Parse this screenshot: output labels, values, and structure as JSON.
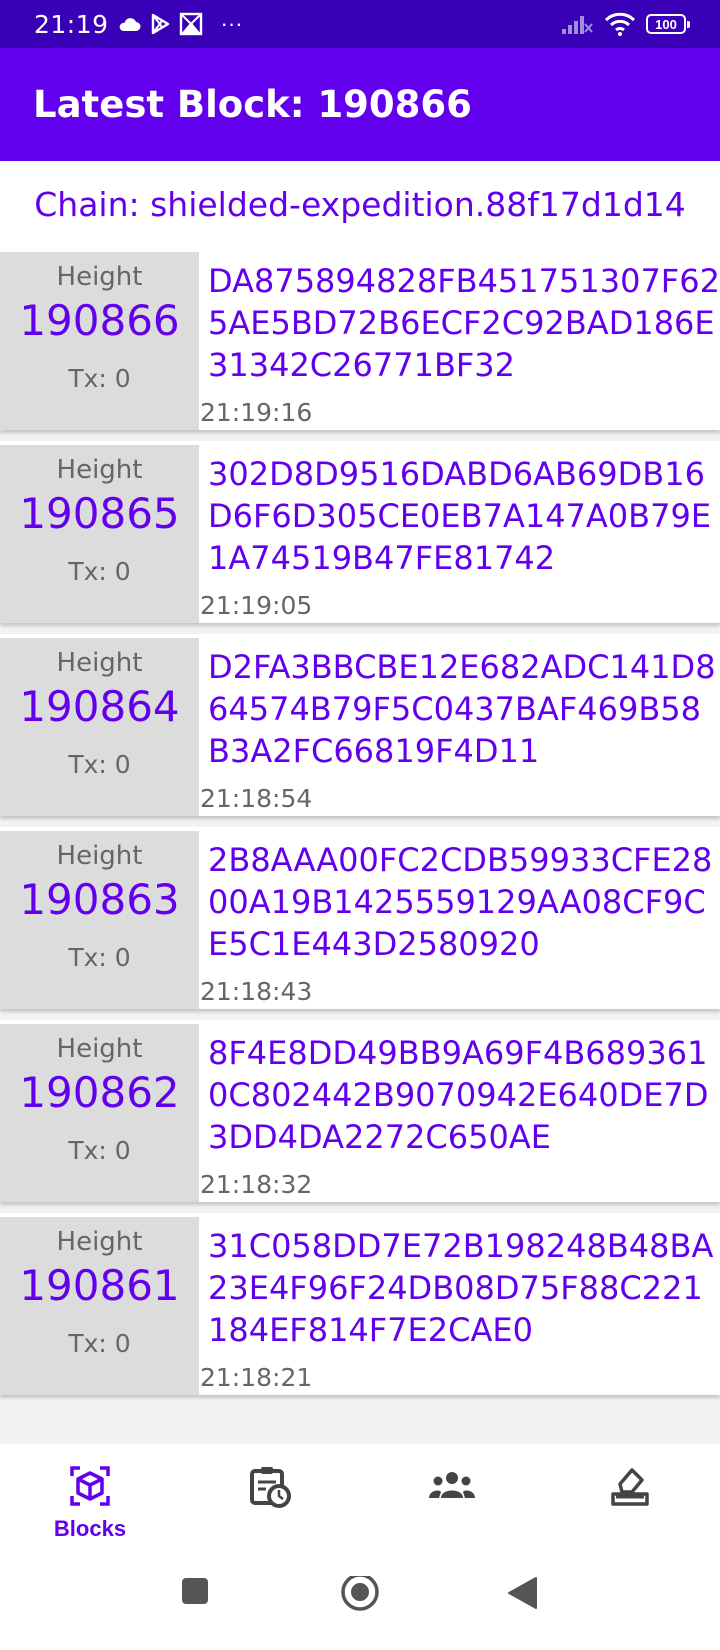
{
  "status_bar": {
    "time": "21:19",
    "more": "···",
    "battery": "100",
    "icons": [
      "cloud-icon",
      "play-store-icon",
      "gallery-icon",
      "signal-icon",
      "wifi-icon",
      "battery-icon"
    ]
  },
  "app_bar": {
    "title": "Latest Block: 190866"
  },
  "chain": {
    "label": "Chain: shielded-expedition.88f17d1d14"
  },
  "blocks": [
    {
      "height_label": "Height",
      "height": "190866",
      "tx": "Tx: 0",
      "hash": "DA875894828FB451751307F625AE5BD72B6ECF2C92BAD186E31342C26771BF32",
      "time": "21:19:16"
    },
    {
      "height_label": "Height",
      "height": "190865",
      "tx": "Tx: 0",
      "hash": "302D8D9516DABD6AB69DB16D6F6D305CE0EB7A147A0B79E1A74519B47FE81742",
      "time": "21:19:05"
    },
    {
      "height_label": "Height",
      "height": "190864",
      "tx": "Tx: 0",
      "hash": "D2FA3BBCBE12E682ADC141D864574B79F5C0437BAF469B58B3A2FC66819F4D11",
      "time": "21:18:54"
    },
    {
      "height_label": "Height",
      "height": "190863",
      "tx": "Tx: 0",
      "hash": "2B8AAA00FC2CDB59933CFE2800A19B1425559129AA08CF9CE5C1E443D2580920",
      "time": "21:18:43"
    },
    {
      "height_label": "Height",
      "height": "190862",
      "tx": "Tx: 0",
      "hash": "8F4E8DD49BB9A69F4B6893610C802442B9070942E640DE7D3DD4DA2272C650AE",
      "time": "21:18:32"
    },
    {
      "height_label": "Height",
      "height": "190861",
      "tx": "Tx: 0",
      "hash": "31C058DD7E72B198248B48BA23E4F96F24DB08D75F88C221184EF814F7E2CAE0",
      "time": "21:18:21"
    }
  ],
  "bottom_nav": {
    "items": [
      {
        "label": "Blocks",
        "icon": "cube-icon",
        "active": true
      },
      {
        "label": "",
        "icon": "schedule-icon",
        "active": false
      },
      {
        "label": "",
        "icon": "group-icon",
        "active": false
      },
      {
        "label": "",
        "icon": "vote-icon",
        "active": false
      }
    ]
  },
  "colors": {
    "primary": "#6200ee",
    "status_bar": "#3a00b8",
    "height_box": "#dcdcdc",
    "muted_text": "#666666"
  }
}
